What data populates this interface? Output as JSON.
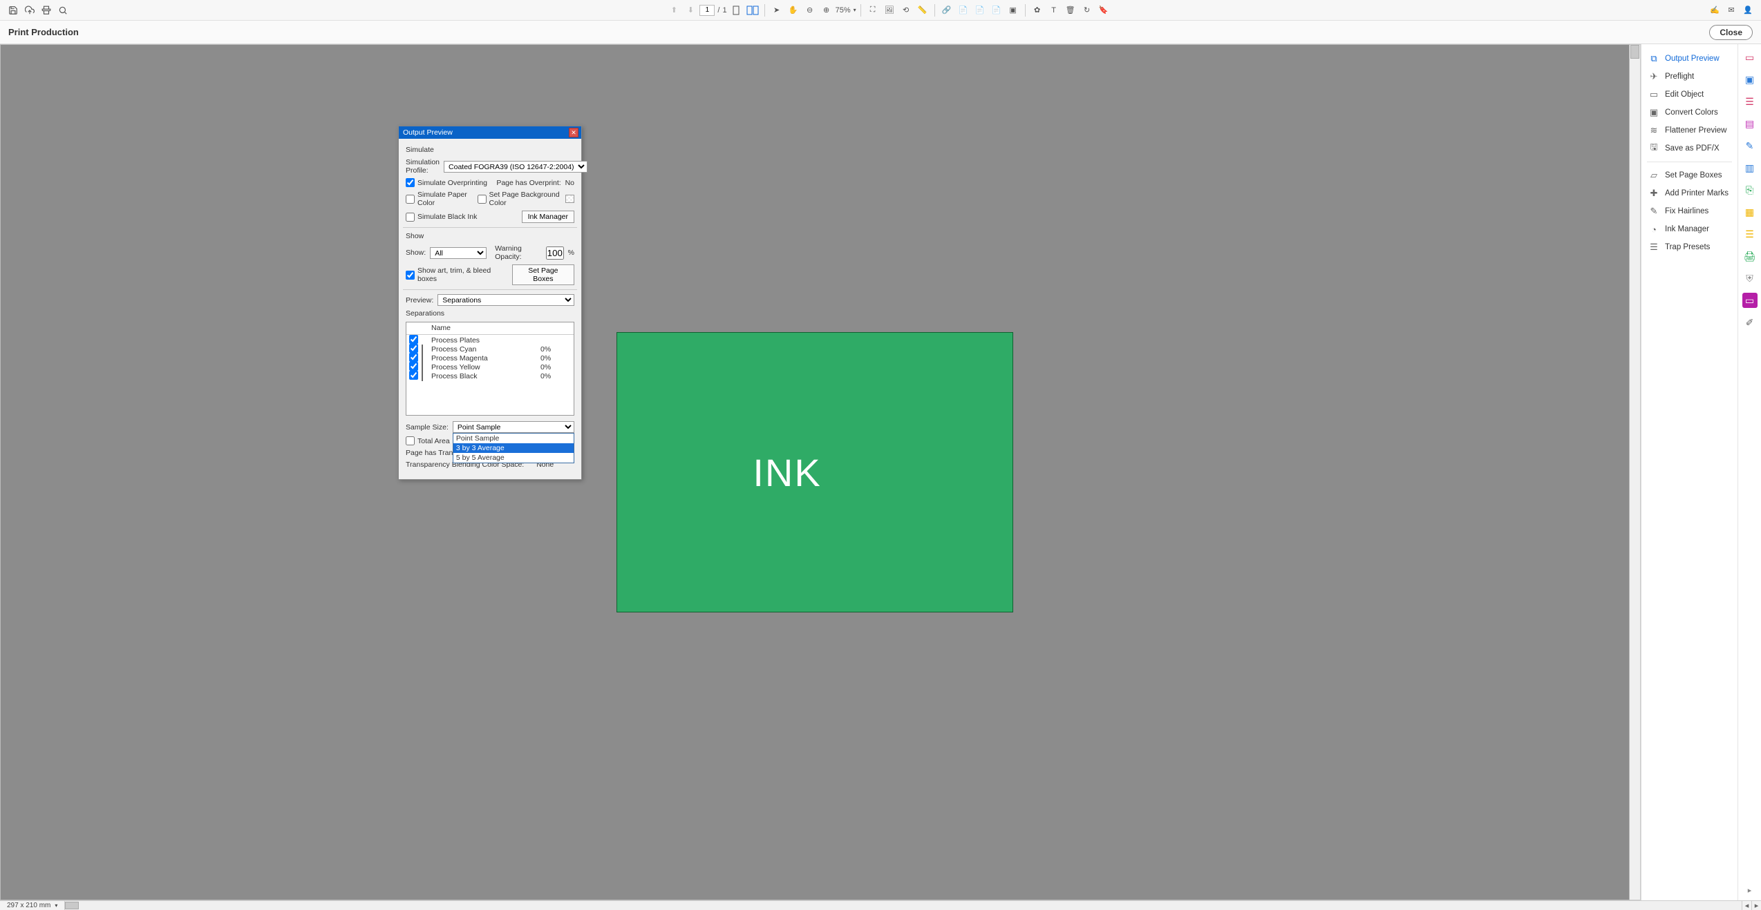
{
  "header": {
    "title": "Print Production",
    "close": "Close"
  },
  "toolbar": {
    "page_current": "1",
    "page_total": "1",
    "zoom": "75%"
  },
  "document": {
    "page_text": "INK"
  },
  "dialog": {
    "title": "Output Preview",
    "simulate_section": "Simulate",
    "sim_profile_label": "Simulation Profile:",
    "sim_profile_value": "Coated FOGRA39 (ISO 12647-2:2004)",
    "simulate_overprinting": "Simulate Overprinting",
    "page_has_overprint_label": "Page has Overprint:",
    "page_has_overprint_value": "No",
    "simulate_paper_color": "Simulate Paper Color",
    "set_page_bg_color": "Set Page Background Color",
    "simulate_black_ink": "Simulate Black Ink",
    "ink_manager_btn": "Ink Manager",
    "show_section": "Show",
    "show_label": "Show:",
    "show_value": "All",
    "warning_opacity_label": "Warning Opacity:",
    "warning_opacity_value": "100",
    "warning_opacity_pct": "%",
    "show_boxes": "Show art, trim, & bleed boxes",
    "set_page_boxes_btn": "Set Page Boxes",
    "preview_label": "Preview:",
    "preview_value": "Separations",
    "separations_section": "Separations",
    "col_name": "Name",
    "plates": [
      {
        "name": "Process Plates",
        "swatch": null,
        "value": ""
      },
      {
        "name": "Process Cyan",
        "swatch": "#00c4ff",
        "value": "0%"
      },
      {
        "name": "Process Magenta",
        "swatch": "#ff1fbf",
        "value": "0%"
      },
      {
        "name": "Process Yellow",
        "swatch": "#fff200",
        "value": "0%"
      },
      {
        "name": "Process Black",
        "swatch": "#000000",
        "value": "0%"
      }
    ],
    "sample_size_label": "Sample Size:",
    "sample_size_value": "Point Sample",
    "sample_size_options": [
      "Point Sample",
      "3 by 3 Average",
      "5 by 5 Average"
    ],
    "sample_size_highlight_index": 1,
    "total_area": "Total Area",
    "page_has_transparency": "Page has Transp",
    "blend_space_label": "Transparency Blending Color Space:",
    "blend_space_value": "None"
  },
  "right_panel": {
    "items": [
      {
        "label": "Output Preview",
        "icon": "⧉",
        "active": true
      },
      {
        "label": "Preflight",
        "icon": "✈"
      },
      {
        "label": "Edit Object",
        "icon": "▭"
      },
      {
        "label": "Convert Colors",
        "icon": "▣"
      },
      {
        "label": "Flattener Preview",
        "icon": "≋"
      },
      {
        "label": "Save as PDF/X",
        "icon": "🖫"
      }
    ],
    "items2": [
      {
        "label": "Set Page Boxes",
        "icon": "▱"
      },
      {
        "label": "Add Printer Marks",
        "icon": "✚"
      },
      {
        "label": "Fix Hairlines",
        "icon": "✎"
      },
      {
        "label": "Ink Manager",
        "icon": "◔"
      },
      {
        "label": "Trap Presets",
        "icon": "☰"
      }
    ]
  },
  "rail_colors": [
    "#d43a6a",
    "#2d7bd8",
    "#d43a6a",
    "#c233b6",
    "#2d7bd8",
    "#16a34a",
    "#f0b400",
    "#f0b400",
    "#16a34a",
    "#888",
    "#b51fa7",
    "#666"
  ],
  "status": {
    "dims": "297 x 210 mm"
  }
}
